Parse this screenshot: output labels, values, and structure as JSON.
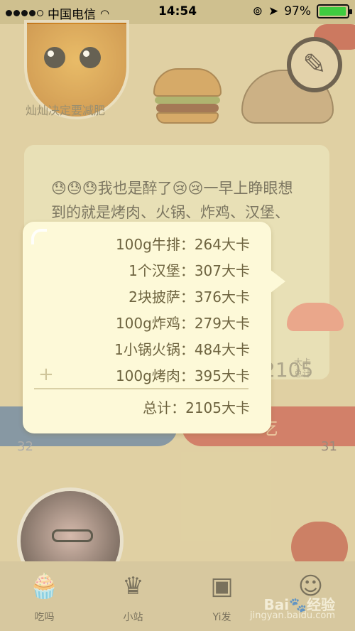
{
  "status_bar": {
    "carrier": "中国电信",
    "time": "14:54",
    "battery": "97%",
    "battery_level": 0.97
  },
  "profile": {
    "username": "灿灿决定要减肥"
  },
  "post": {
    "text": "😓😓😓我也是醉了😢😢一早上睁眼想到的就是烤肉、火锅、炸鸡、汉堡、披萨、牛排，我要吃了吗"
  },
  "background_calories": {
    "value": "2105",
    "unit_line1": "大卡",
    "unit_line2": "总计"
  },
  "actions": {
    "eat_button": "吃",
    "left_count": "32",
    "right_count": "31"
  },
  "calorie_popover": {
    "items": [
      "100g牛排：264大卡",
      "1个汉堡：307大卡",
      "2块披萨：376大卡",
      "100g炸鸡：279大卡",
      "1小锅火锅：484大卡",
      "100g烤肉：395大卡"
    ],
    "total": "总计：2105大卡"
  },
  "tab_bar": {
    "tabs": [
      {
        "label": "吃吗",
        "icon": "cupcake-icon"
      },
      {
        "label": "小站",
        "icon": "crown-icon"
      },
      {
        "label": "Yi发",
        "icon": "photo-cards-icon"
      },
      {
        "label": "",
        "icon": "chef-icon"
      }
    ]
  },
  "watermark": {
    "brand": "Bai🐾经验",
    "url": "jingyan.baidu.com"
  }
}
